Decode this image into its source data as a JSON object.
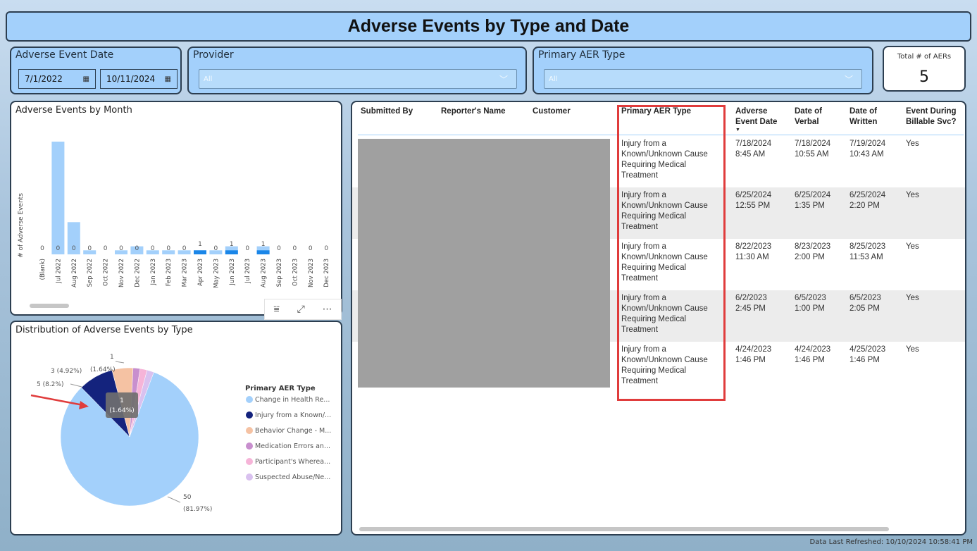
{
  "title": "Adverse Events by Type and Date",
  "filters": {
    "date": {
      "label": "Adverse Event Date",
      "start": "7/1/2022",
      "end": "10/11/2024"
    },
    "provider": {
      "label": "Provider",
      "value": "All"
    },
    "aer_type": {
      "label": "Primary AER Type",
      "value": "All"
    }
  },
  "kpi": {
    "label": "Total # of AERs",
    "value": "5"
  },
  "monthly_chart": {
    "title": "Adverse Events by Month",
    "ylabel": "# of Adverse Events",
    "toolbar": {
      "filter_icon": "⩸",
      "focus_icon": "⤢",
      "more_icon": "⋯"
    }
  },
  "pie_chart": {
    "title": "Distribution of Adverse Events by Type",
    "legend_title": "Primary AER Type",
    "tooltip": {
      "count": "1",
      "pct": "(1.64%)"
    },
    "slice_labels": {
      "big": "50",
      "big_pct": "(81.97%)",
      "s5": "5 (8.2%)",
      "s3": "3 (4.92%)",
      "s1a": "(1.64%)",
      "s1b": "1"
    }
  },
  "chart_data": [
    {
      "type": "bar",
      "title": "Adverse Events by Month",
      "ylabel": "# of Adverse Events",
      "categories": [
        "(Blank)",
        "Jul 2022",
        "Aug 2022",
        "Sep 2022",
        "Oct 2022",
        "Nov 2022",
        "Dec 2022",
        "Jan 2023",
        "Feb 2023",
        "Mar 2023",
        "Apr 2023",
        "May 2023",
        "Jun 2023",
        "Jul 2023",
        "Aug 2023",
        "Sep 2023",
        "Oct 2023",
        "Nov 2023",
        "Dec 2023"
      ],
      "series": [
        {
          "name": "All",
          "values": [
            0,
            28,
            8,
            1,
            0,
            1,
            2,
            1,
            1,
            1,
            1,
            1,
            2,
            0,
            2,
            0,
            0,
            0,
            0
          ]
        },
        {
          "name": "Selected",
          "values": [
            0,
            0,
            0,
            0,
            0,
            0,
            0,
            0,
            0,
            0,
            1,
            0,
            1,
            0,
            1,
            0,
            0,
            0,
            0
          ]
        }
      ],
      "labels": [
        "0",
        "0",
        "0",
        "0",
        "0",
        "0",
        "0",
        "0",
        "0",
        "0",
        "1",
        "0",
        "1",
        "0",
        "1",
        "0",
        "0",
        "0",
        "0"
      ],
      "colors": {
        "all": "#a3d0fb",
        "selected": "#1a86e8"
      }
    },
    {
      "type": "pie",
      "title": "Distribution of Adverse Events by Type",
      "legend_title": "Primary AER Type",
      "slices": [
        {
          "name": "Change in Health Re...",
          "value": 50,
          "color": "#a3d0fb"
        },
        {
          "name": "Injury from a Known/...",
          "value": 5,
          "color": "#14237d"
        },
        {
          "name": "Behavior Change - M...",
          "value": 3,
          "color": "#f5c2a3"
        },
        {
          "name": "Medication Errors an...",
          "value": 1,
          "color": "#c88fce"
        },
        {
          "name": "Participant's Wherea...",
          "value": 1,
          "color": "#f6b4d8"
        },
        {
          "name": "Suspected Abuse/Ne...",
          "value": 1,
          "color": "#d9c1ef"
        }
      ]
    }
  ],
  "table": {
    "headers": {
      "submitted": "Submitted By",
      "reporter": "Reporter's Name",
      "customer": "Customer",
      "aer_type": "Primary AER Type",
      "event_date_1": "Adverse",
      "event_date_2": "Event Date",
      "verbal_1": "Date of",
      "verbal_2": "Verbal",
      "written_1": "Date of",
      "written_2": "Written",
      "billable_1": "Event During",
      "billable_2": "Billable Svc?"
    },
    "rows": [
      {
        "type_l1": "Injury from a",
        "type_l2": "Known/Unknown Cause",
        "type_l3": "Requiring Medical",
        "type_l4": "Treatment",
        "event_d": "7/18/2024",
        "event_t": "8:45 AM",
        "verbal_d": "7/18/2024",
        "verbal_t": "10:55 AM",
        "written_d": "7/19/2024",
        "written_t": "10:43 AM",
        "billable": "Yes"
      },
      {
        "type_l1": "Injury from a",
        "type_l2": "Known/Unknown Cause",
        "type_l3": "Requiring Medical",
        "type_l4": "Treatment",
        "event_d": "6/25/2024",
        "event_t": "12:55 PM",
        "verbal_d": "6/25/2024",
        "verbal_t": "1:35 PM",
        "written_d": "6/25/2024",
        "written_t": "2:20 PM",
        "billable": "Yes"
      },
      {
        "type_l1": "Injury from a",
        "type_l2": "Known/Unknown Cause",
        "type_l3": "Requiring Medical",
        "type_l4": "Treatment",
        "event_d": "8/22/2023",
        "event_t": "11:30 AM",
        "verbal_d": "8/23/2023",
        "verbal_t": "2:00 PM",
        "written_d": "8/25/2023",
        "written_t": "11:53 AM",
        "billable": "Yes"
      },
      {
        "type_l1": "Injury from a",
        "type_l2": "Known/Unknown Cause",
        "type_l3": "Requiring Medical",
        "type_l4": "Treatment",
        "event_d": "6/2/2023",
        "event_t": "2:45 PM",
        "verbal_d": "6/5/2023",
        "verbal_t": "1:00 PM",
        "written_d": "6/5/2023",
        "written_t": "2:05 PM",
        "billable": "Yes"
      },
      {
        "type_l1": "Injury from a",
        "type_l2": "Known/Unknown Cause",
        "type_l3": "Requiring Medical",
        "type_l4": "Treatment",
        "event_d": "4/24/2023",
        "event_t": "1:46 PM",
        "verbal_d": "4/24/2023",
        "verbal_t": "1:46 PM",
        "written_d": "4/25/2023",
        "written_t": "1:46 PM",
        "billable": "Yes"
      }
    ]
  },
  "footer": "Data Last Refreshed: 10/10/2024 10:58:41 PM"
}
